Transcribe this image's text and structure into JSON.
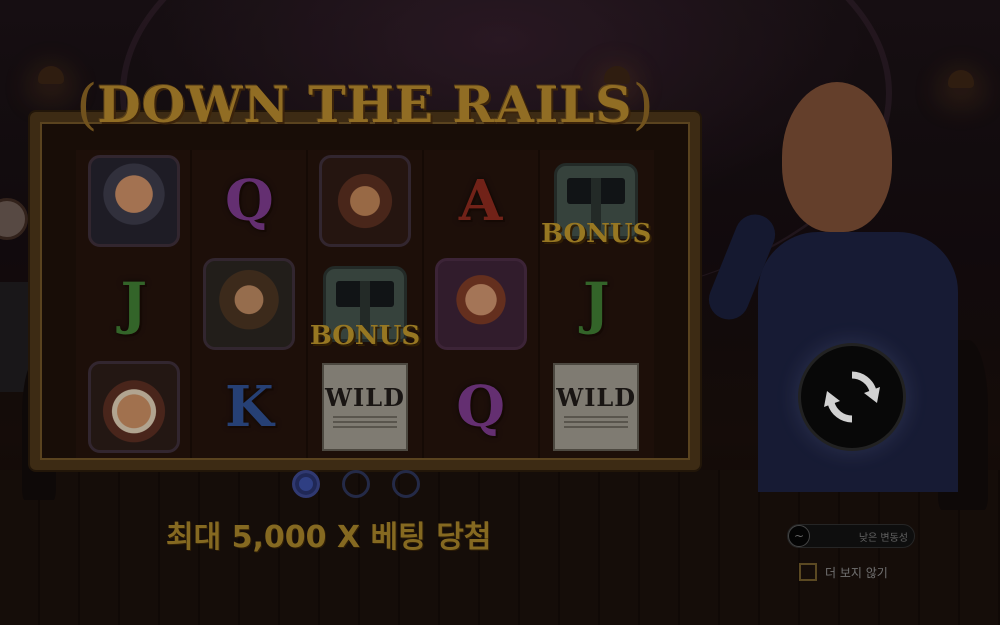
{
  "game": {
    "title": "DOWN THE RAILS",
    "title_paren_left": "(",
    "title_paren_right": ")"
  },
  "reels": [
    [
      {
        "kind": "portrait",
        "icon": "bald-man-portrait-icon"
      },
      {
        "kind": "letter",
        "text": "J",
        "color": "#3f7a33"
      },
      {
        "kind": "portrait",
        "icon": "king-portrait-icon"
      }
    ],
    [
      {
        "kind": "letter",
        "text": "Q",
        "color": "#7b3a8a"
      },
      {
        "kind": "portrait",
        "icon": "wigged-man-portrait-icon"
      },
      {
        "kind": "letter",
        "text": "K",
        "color": "#2f4f8f"
      }
    ],
    [
      {
        "kind": "portrait",
        "icon": "cavalier-portrait-icon"
      },
      {
        "kind": "bonus",
        "text": "BONUS",
        "icon": "train-icon"
      },
      {
        "kind": "wild",
        "text": "WILD",
        "icon": "newspaper-icon"
      }
    ],
    [
      {
        "kind": "letter",
        "text": "A",
        "color": "#8a2a1e"
      },
      {
        "kind": "portrait",
        "icon": "lady-portrait-icon"
      },
      {
        "kind": "letter",
        "text": "Q",
        "color": "#7b3a8a"
      }
    ],
    [
      {
        "kind": "bonus",
        "text": "BONUS",
        "icon": "train-icon"
      },
      {
        "kind": "letter",
        "text": "J",
        "color": "#3f7a33"
      },
      {
        "kind": "wild",
        "text": "WILD",
        "icon": "newspaper-icon"
      }
    ]
  ],
  "pagination": {
    "pages": 3,
    "active": 1
  },
  "promo_text": "최대 5,000 X 베팅 당첨",
  "volatility": {
    "label": "낮은 변동성",
    "icon": "volatility-icon"
  },
  "dont_show": {
    "label": "더 보지 않기",
    "checked": false
  },
  "spin": {
    "icon": "refresh-icon"
  },
  "colors": {
    "gold": "#b1862d",
    "frame": "#4b3519",
    "spin_bg": "#0a0a0a"
  }
}
